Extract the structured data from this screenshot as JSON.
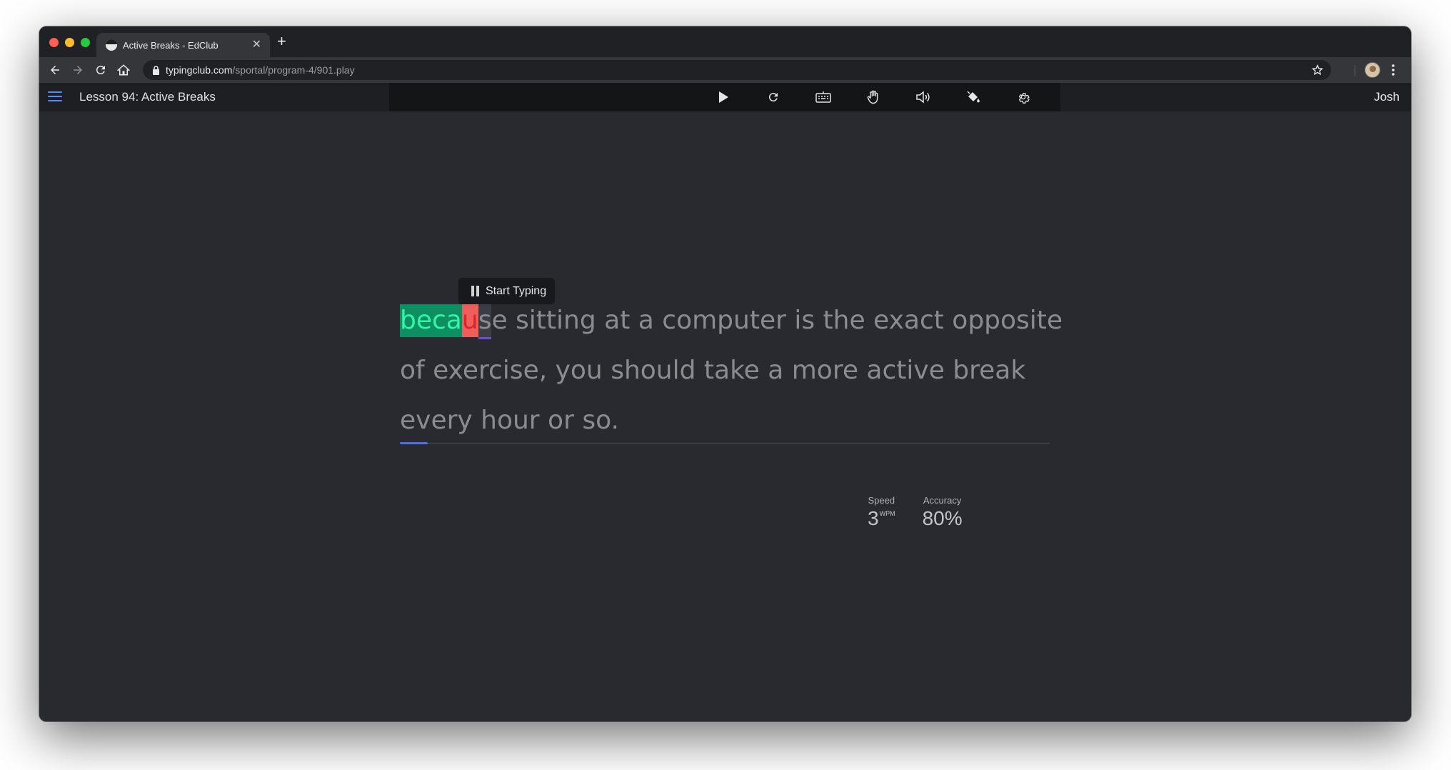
{
  "browser": {
    "tab": {
      "title": "Active Breaks - EdClub",
      "favicon": "edclub-favicon"
    },
    "new_tab_label": "+",
    "close_label": "✕",
    "url": {
      "host": "typingclub.com",
      "path": "/sportal/program-4/901.play"
    },
    "traffic_lights": [
      "#ff5f57",
      "#febc2e",
      "#28c840"
    ]
  },
  "app": {
    "lesson_title": "Lesson 94: Active Breaks",
    "user_name": "Josh",
    "tools": [
      "play-icon",
      "restart-icon",
      "keyboard-icon",
      "hand-icon",
      "sound-icon",
      "theme-bucket-icon",
      "settings-gear-icon"
    ]
  },
  "typing": {
    "tooltip": "Start Typing",
    "line1": {
      "done": "beca",
      "error": "u",
      "cursor": "s",
      "rest": "e sitting at a computer is the exact opposite"
    },
    "line2": "of exercise, you should take a more active break",
    "line3": "every hour or so.",
    "progress_percent": 4.3
  },
  "stats": {
    "speed_label": "Speed",
    "speed_value": "3",
    "speed_unit": "WPM",
    "accuracy_label": "Accuracy",
    "accuracy_value": "80%"
  },
  "colors": {
    "correct_bg": "#0d8f62",
    "correct_text": "#32f5a7",
    "error_bg": "#f05e5b",
    "accent": "#5b8af5"
  }
}
